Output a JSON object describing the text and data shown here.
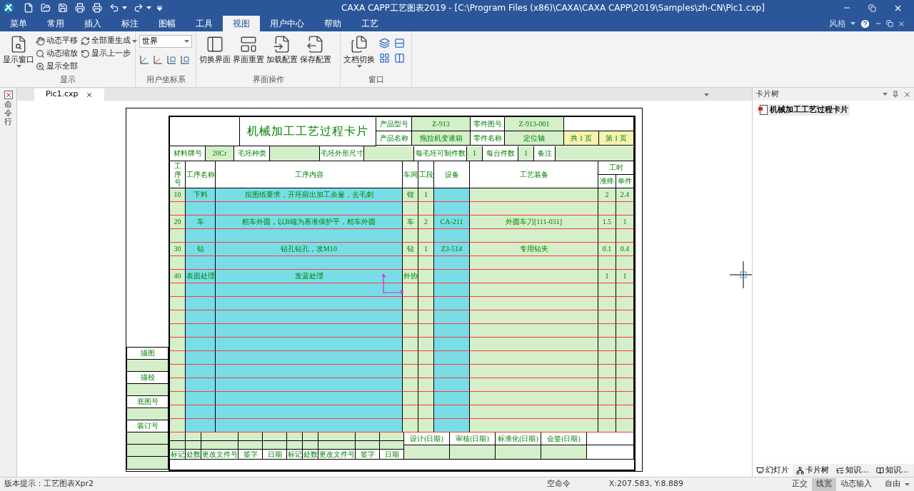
{
  "window": {
    "title": "CAXA CAPP工艺图表2019 - [C:\\Program Files (x86)\\CAXA\\CAXA CAPP\\2019\\Samples\\zh-CN\\Pic1.cxp]",
    "style_label": "风格"
  },
  "menu_tabs": [
    {
      "label": "菜单",
      "selected": false
    },
    {
      "label": "常用",
      "selected": false
    },
    {
      "label": "插入",
      "selected": false
    },
    {
      "label": "标注",
      "selected": false
    },
    {
      "label": "图幅",
      "selected": false
    },
    {
      "label": "工具",
      "selected": false
    },
    {
      "label": "视图",
      "selected": true
    },
    {
      "label": "用户中心",
      "selected": false
    },
    {
      "label": "帮助",
      "selected": false
    },
    {
      "label": "工艺",
      "selected": false
    }
  ],
  "ribbon": [
    {
      "title": "显示",
      "large": [
        "显示窗口"
      ],
      "small": [
        "动态平移",
        "动态缩放",
        "显示全部",
        "全部重生成",
        "显示上一步"
      ]
    },
    {
      "title": "用户坐标系",
      "dropdown": "世界"
    },
    {
      "title": "界面操作",
      "large": [
        "切换界面",
        "界面重置",
        "加载配置",
        "保存配置"
      ]
    },
    {
      "title": "窗口",
      "large": [
        "文档切换"
      ]
    }
  ],
  "command_line": "命令行",
  "documents": [
    {
      "label": "Pic1.cxp",
      "selected": true
    }
  ],
  "card": {
    "title": "机械加工工艺过程卡片",
    "info": [
      {
        "label": "产品型号",
        "value": "Z-913"
      },
      {
        "label": "零件图号",
        "value": "Z-913-001"
      },
      {
        "label": "产品名称",
        "value": "拖拉机变速箱"
      },
      {
        "label": "零件名称",
        "value": "定位轴"
      }
    ],
    "pages": [
      "共 1 页",
      "第 1 页"
    ],
    "material": [
      {
        "label": "材料牌号",
        "value": "20Cr"
      },
      {
        "label": "毛坯种类"
      },
      {
        "label": "毛坯外形尺寸"
      },
      {
        "label": "每毛坯可制件数",
        "value": "1"
      },
      {
        "label": "每台件数",
        "value": "1"
      },
      {
        "label": "备注"
      }
    ],
    "columns": [
      "工序号",
      "工序名称",
      "工序内容",
      "车间",
      "工段",
      "设备",
      "工艺装备"
    ],
    "hours": {
      "label": "工时",
      "sub": [
        "准终",
        "单件"
      ]
    },
    "operations": [
      {
        "no": "10",
        "name": "下料",
        "content": "按图纸要求，开坯留出加工余量，去毛刺",
        "workshop": "钳",
        "section": "1",
        "prep": "2",
        "unit": "2.4"
      },
      {
        "no": "20",
        "name": "车",
        "content": "粗车外圆，以B端为基准保护平，精车外圆",
        "workshop": "车",
        "section": "2",
        "equipment": "CA-211",
        "tooling": "外圆车刀[111-031]",
        "prep": "1.5",
        "unit": "1"
      },
      {
        "no": "30",
        "name": "钻",
        "content": "钻孔钻孔，攻M10",
        "workshop": "钻",
        "section": "1",
        "equipment": "Z3-514",
        "tooling": "专用钻夹",
        "prep": "0.1",
        "unit": "0.4"
      },
      {
        "no": "40",
        "name": "表面处理",
        "content": "发蓝处理",
        "workshop": "外协",
        "prep": "1",
        "unit": "1"
      }
    ],
    "change_columns": [
      "标记",
      "处数",
      "更改文件号",
      "签字",
      "日期",
      "标记",
      "处数",
      "更改文件号",
      "签字",
      "日期"
    ],
    "signatures": [
      "设计(日期)",
      "审核(日期)",
      "标准化(日期)",
      "会签(日期)"
    ],
    "archive": [
      "描图",
      "描校",
      "底图号",
      "装订号"
    ]
  },
  "card_tree": {
    "title": "卡片树",
    "items": [
      {
        "label": "机械加工工艺过程卡片",
        "selected": true
      }
    ]
  },
  "panel_tabs": [
    {
      "label": "幻灯片",
      "selected": true
    },
    {
      "label": "卡片树",
      "selected": false
    },
    {
      "label": "知识...",
      "selected": false
    },
    {
      "label": "知识...",
      "selected": false
    }
  ],
  "status_bar": {
    "hint": "版本提示：工艺图表Xpr2",
    "command": "空命令",
    "coordinates": "X:207.583, Y:8.889",
    "toggles": [
      {
        "label": "正交",
        "on": false
      },
      {
        "label": "线宽",
        "on": true
      },
      {
        "label": "动态输入",
        "on": false
      }
    ],
    "snap_mode": "自由"
  }
}
